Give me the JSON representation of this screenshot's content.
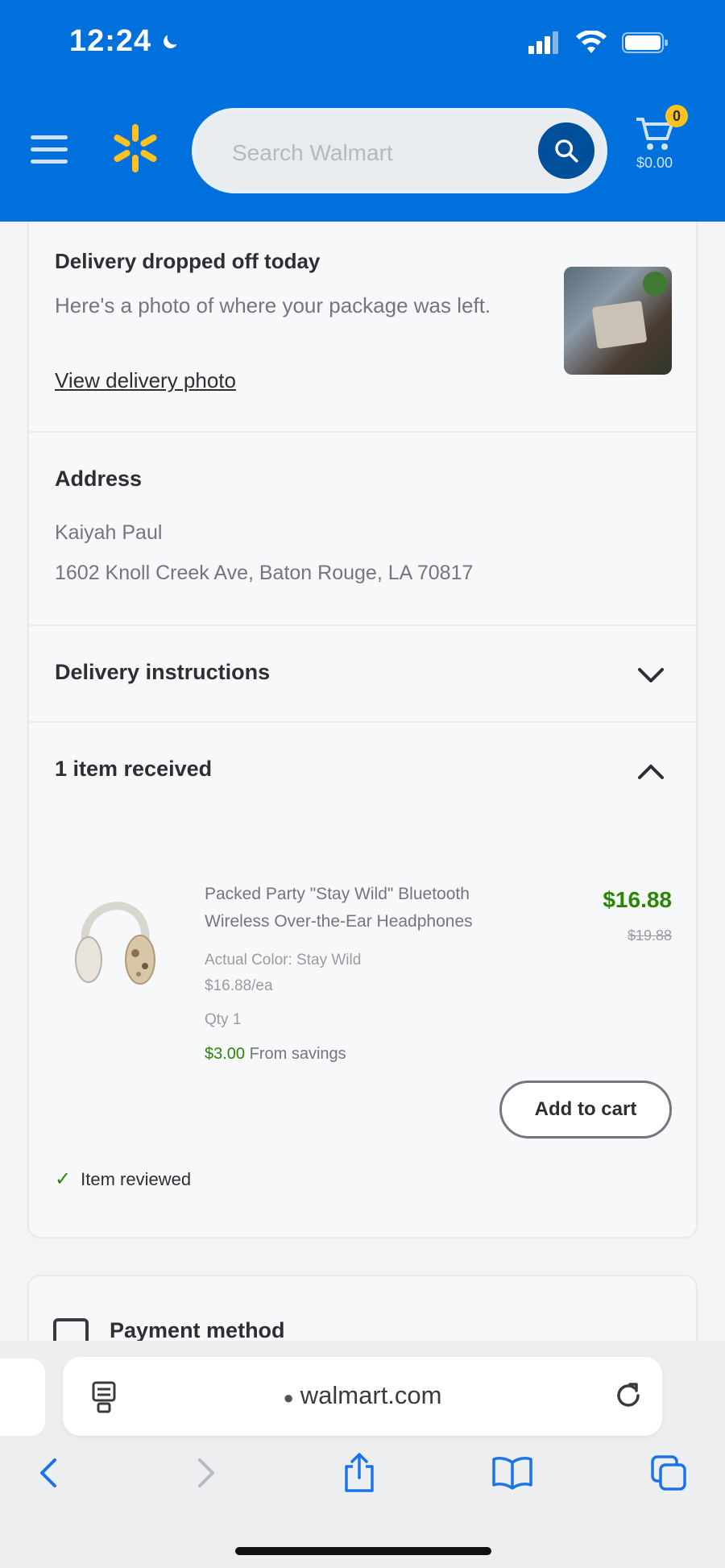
{
  "status_bar": {
    "time": "12:24"
  },
  "header": {
    "search_placeholder": "Search Walmart",
    "cart_badge": "0",
    "cart_total": "$0.00",
    "colors": {
      "brand_blue": "#0071dc",
      "spark_yellow": "#ffc220"
    }
  },
  "delivery": {
    "title": "Delivery dropped off today",
    "description": "Here's a photo of where your package was left.",
    "link": "View delivery photo"
  },
  "address": {
    "title": "Address",
    "name": "Kaiyah Paul",
    "line": "1602 Knoll Creek Ave, Baton Rouge, LA 70817"
  },
  "instructions": {
    "title": "Delivery instructions"
  },
  "items": {
    "title": "1 item received",
    "product": {
      "name": "Packed Party \"Stay Wild\" Bluetooth Wireless Over-the-Ear Headphones",
      "color": "Actual Color: Stay Wild",
      "unit_price": "$16.88/ea",
      "qty": "Qty 1",
      "price": "$16.88",
      "was_price": "$19.88",
      "savings_amount": "$3.00",
      "savings_label": "From savings",
      "add_to_cart": "Add to cart"
    },
    "reviewed": "Item reviewed"
  },
  "payment": {
    "title": "Payment method"
  },
  "browser": {
    "url": "walmart.com"
  }
}
